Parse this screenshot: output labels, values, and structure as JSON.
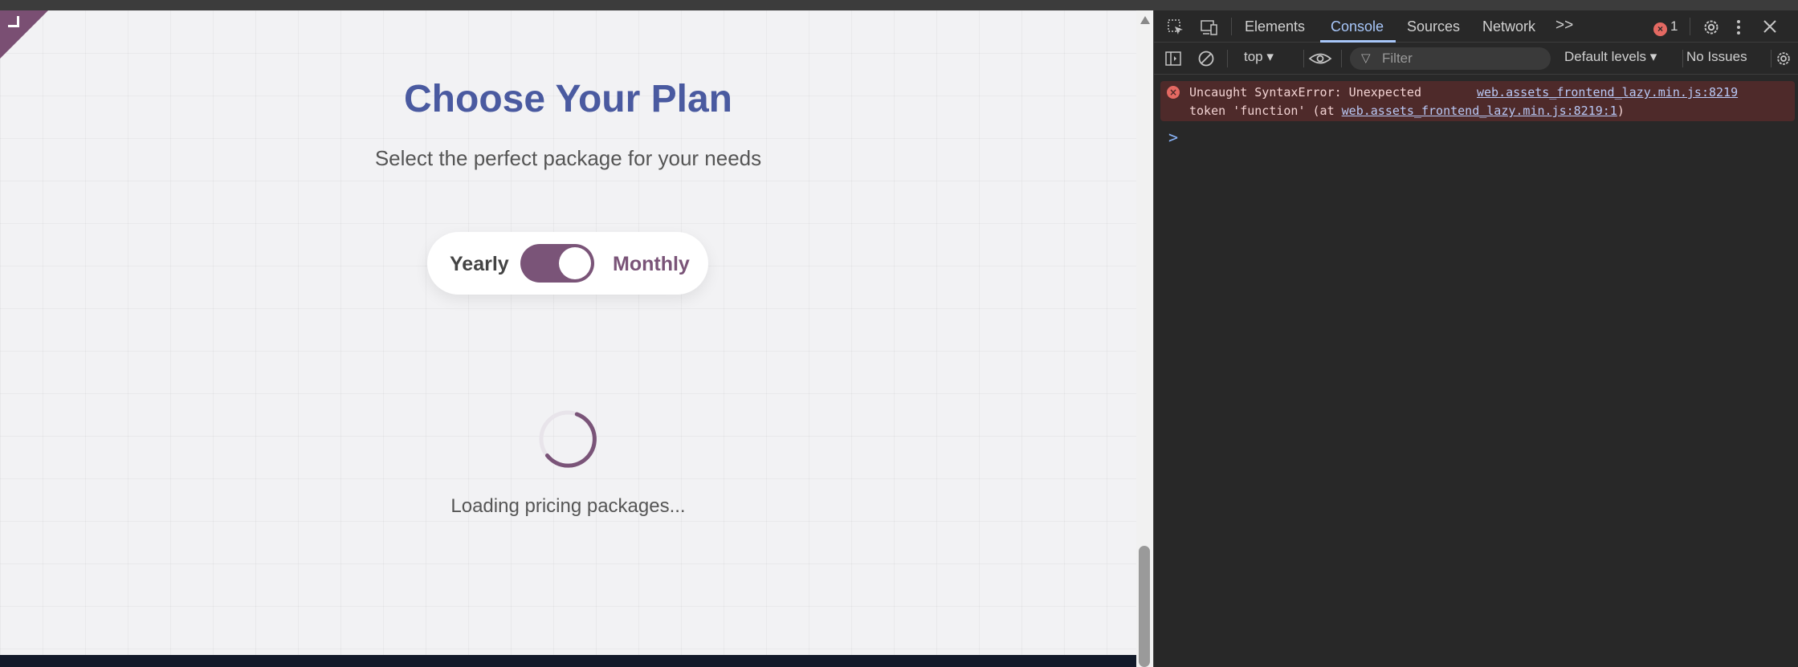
{
  "page": {
    "title": "Choose Your Plan",
    "subtitle": "Select the perfect package for your needs",
    "toggle": {
      "left_label": "Yearly",
      "right_label": "Monthly",
      "state": "on"
    },
    "loading_text": "Loading pricing packages..."
  },
  "devtools": {
    "tabs": [
      {
        "label": "Elements",
        "active": false
      },
      {
        "label": "Console",
        "active": true
      },
      {
        "label": "Sources",
        "active": false
      },
      {
        "label": "Network",
        "active": false
      }
    ],
    "more_tabs": ">>",
    "error_count": "1",
    "toolbar": {
      "context": "top",
      "filter_placeholder": "Filter",
      "levels": "Default levels",
      "issues": "No Issues"
    },
    "console": {
      "error_line1": "Uncaught SyntaxError: Unexpected",
      "error_line2_prefix": "token 'function' (at ",
      "error_link1": "web.assets_frontend_lazy.min.js:8219",
      "error_link2": "web.assets_frontend_lazy.min.js:8219:1",
      "error_line2_suffix": ")",
      "prompt": ">"
    }
  },
  "colors": {
    "title": "#4a5aa0",
    "accent": "#7a5478",
    "console_error_bg": "#4e2a2a",
    "devtools_active": "#a8c7fa"
  }
}
